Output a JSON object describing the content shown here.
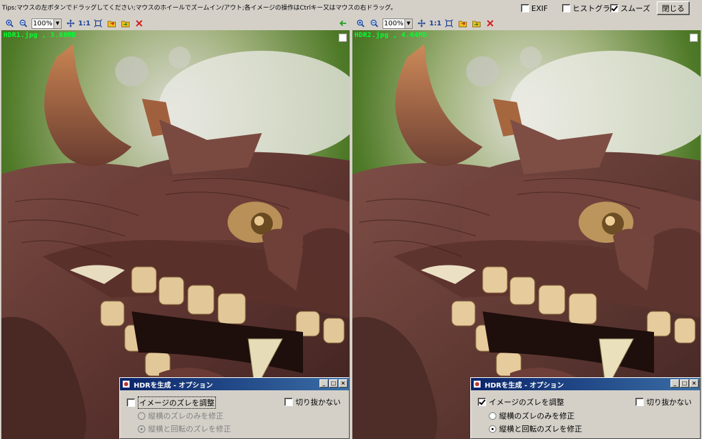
{
  "topbar": {
    "tips": "Tips:マウスの左ボタンでドラッグしてください;マウスのホイールでズームイン/アウト;各イメージの操作はCtrlキー又はマウスの右ドラッグ。",
    "exif_label": "EXIF",
    "histogram_label": "ヒストグラム",
    "smooth_label": "スムーズ",
    "close_label": "閉じる"
  },
  "panes": [
    {
      "zoom": "100%",
      "ratio_label": "1:1",
      "file_label": "HDR1.jpg , 3.88MB"
    },
    {
      "zoom": "100%",
      "ratio_label": "1:1",
      "file_label": "HDR2.jpg , 4.04MB"
    }
  ],
  "dialogs": [
    {
      "title": "HDRを生成 - オプション",
      "adjust_label": "イメージのズレを調整",
      "nocrop_label": "切り抜かない",
      "radio1_label": "縦横のズレのみを修正",
      "radio2_label": "縦横と回転のズレを修正"
    },
    {
      "title": "HDRを生成 - オプション",
      "adjust_label": "イメージのズレを調整",
      "nocrop_label": "切り抜かない",
      "radio1_label": "縦横のズレのみを修正",
      "radio2_label": "縦横と回転のズレを修正"
    }
  ],
  "icons": [
    "zoom-in-icon",
    "zoom-out-icon",
    "fit-icon",
    "fullscreen-icon",
    "open-folder-icon",
    "save-icon",
    "close-x-icon",
    "back-arrow-icon"
  ],
  "colors": {
    "file_label": "#00ff33",
    "titlebar": "#0a246a",
    "close_x": "#d02020"
  }
}
